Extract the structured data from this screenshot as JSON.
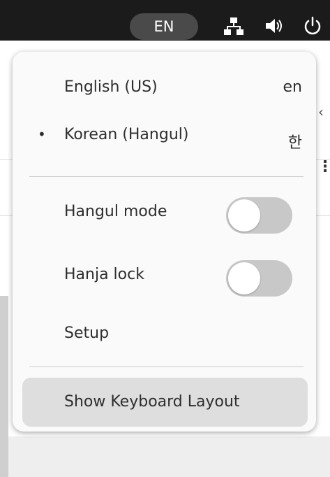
{
  "top_bar": {
    "input_indicator": "EN",
    "icons": [
      "network-icon",
      "volume-icon",
      "power-icon"
    ]
  },
  "menu": {
    "languages": [
      {
        "label": "English (US)",
        "code": "en",
        "selected": false
      },
      {
        "label": "Korean (Hangul)",
        "code": "한",
        "selected": true,
        "bullet": "•"
      }
    ],
    "toggles": [
      {
        "label": "Hangul mode",
        "state": "off"
      },
      {
        "label": "Hanja lock",
        "state": "off"
      }
    ],
    "setup_label": "Setup",
    "show_keyboard_label": "Show Keyboard Layout"
  },
  "colors": {
    "top_bar_bg": "#1b1b1b",
    "indicator_bg": "#4a4a4a",
    "menu_bg": "#fafafa",
    "toggle_off_track": "#c8c8c8",
    "hover_bg": "#dedede",
    "text": "#2e2e2e"
  }
}
